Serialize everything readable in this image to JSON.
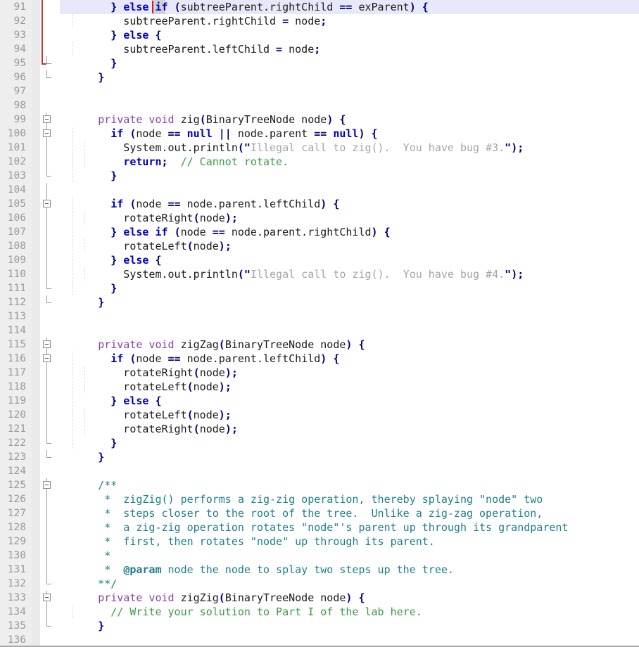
{
  "editor": {
    "language": "Java",
    "first_line": 91,
    "last_line": 136,
    "colors": {
      "background": "#ffffff",
      "gutter": "#eeeeee",
      "line_number": "#999999",
      "current_line_highlight": "#e8e8fb",
      "keyword": "#0000c8",
      "modifier": "#8b3fa8",
      "punctuation": "#000080",
      "string": "#a5a5a5",
      "line_comment": "#3a9b45",
      "javadoc": "#1c7f8c",
      "change_marker": "#c0392b",
      "caret": "#cc2222",
      "brace_match": "#c9c9c9"
    },
    "caret": {
      "line": 91,
      "column": 11
    },
    "brace_match_token": "if"
  },
  "lines": [
    {
      "n": 91,
      "current": true,
      "change": "bar",
      "indent": 0,
      "tokens": [
        {
          "t": "        ",
          "c": "id"
        },
        {
          "t": "}",
          "c": "p"
        },
        {
          "t": " ",
          "c": "id"
        },
        {
          "t": "else",
          "c": "k"
        },
        {
          "t": " ",
          "c": "id"
        },
        {
          "t": "if",
          "c": "k",
          "match": true
        },
        {
          "t": " ",
          "c": "id"
        },
        {
          "t": "(",
          "c": "p"
        },
        {
          "t": "subtreeParent.rightChild ",
          "c": "id"
        },
        {
          "t": "==",
          "c": "p"
        },
        {
          "t": " exParent",
          "c": "id"
        },
        {
          "t": ")",
          "c": "p"
        },
        {
          "t": " ",
          "c": "id"
        },
        {
          "t": "{",
          "c": "p"
        }
      ]
    },
    {
      "n": 92,
      "change": "bar",
      "indent": 1,
      "tokens": [
        {
          "t": "          subtreeParent.rightChild ",
          "c": "id"
        },
        {
          "t": "=",
          "c": "p"
        },
        {
          "t": " node",
          "c": "id"
        },
        {
          "t": ";",
          "c": "p"
        }
      ]
    },
    {
      "n": 93,
      "change": "bar",
      "indent": 0,
      "tokens": [
        {
          "t": "        ",
          "c": "id"
        },
        {
          "t": "}",
          "c": "p"
        },
        {
          "t": " ",
          "c": "id"
        },
        {
          "t": "else",
          "c": "k"
        },
        {
          "t": " ",
          "c": "id"
        },
        {
          "t": "{",
          "c": "p"
        }
      ]
    },
    {
      "n": 94,
      "change": "bar",
      "indent": 1,
      "tokens": [
        {
          "t": "          subtreeParent.leftChild ",
          "c": "id"
        },
        {
          "t": "=",
          "c": "p"
        },
        {
          "t": " node",
          "c": "id"
        },
        {
          "t": ";",
          "c": "p"
        }
      ]
    },
    {
      "n": 95,
      "change": "end",
      "fold": "stub",
      "indent": 0,
      "tokens": [
        {
          "t": "        ",
          "c": "id"
        },
        {
          "t": "}",
          "c": "p"
        }
      ]
    },
    {
      "n": 96,
      "fold": "stub",
      "tokens": [
        {
          "t": "      ",
          "c": "id"
        },
        {
          "t": "}",
          "c": "p"
        }
      ]
    },
    {
      "n": 97,
      "tokens": []
    },
    {
      "n": 98,
      "tokens": []
    },
    {
      "n": 99,
      "fold": "box",
      "tokens": [
        {
          "t": "      ",
          "c": "id"
        },
        {
          "t": "private void",
          "c": "mod"
        },
        {
          "t": " zig",
          "c": "id"
        },
        {
          "t": "(",
          "c": "p"
        },
        {
          "t": "BinaryTreeNode node",
          "c": "id"
        },
        {
          "t": ")",
          "c": "p"
        },
        {
          "t": " ",
          "c": "id"
        },
        {
          "t": "{",
          "c": "p"
        }
      ]
    },
    {
      "n": 100,
      "fold": "box",
      "indent": 1,
      "tokens": [
        {
          "t": "        ",
          "c": "id"
        },
        {
          "t": "if",
          "c": "k"
        },
        {
          "t": " ",
          "c": "id"
        },
        {
          "t": "(",
          "c": "p"
        },
        {
          "t": "node ",
          "c": "id"
        },
        {
          "t": "==",
          "c": "p"
        },
        {
          "t": " ",
          "c": "id"
        },
        {
          "t": "null",
          "c": "k"
        },
        {
          "t": " ",
          "c": "id"
        },
        {
          "t": "||",
          "c": "p"
        },
        {
          "t": " node.parent ",
          "c": "id"
        },
        {
          "t": "==",
          "c": "p"
        },
        {
          "t": " ",
          "c": "id"
        },
        {
          "t": "null",
          "c": "k"
        },
        {
          "t": ")",
          "c": "p"
        },
        {
          "t": " ",
          "c": "id"
        },
        {
          "t": "{",
          "c": "p"
        }
      ]
    },
    {
      "n": 101,
      "fold": "line",
      "indent": 2,
      "tokens": [
        {
          "t": "          System.out.println",
          "c": "id"
        },
        {
          "t": "(\"",
          "c": "p"
        },
        {
          "t": "Illegal call to zig().  You have bug #3.",
          "c": "str"
        },
        {
          "t": "\")",
          "c": "p"
        },
        {
          "t": ";",
          "c": "p"
        }
      ]
    },
    {
      "n": 102,
      "fold": "line",
      "indent": 2,
      "tokens": [
        {
          "t": "          ",
          "c": "id"
        },
        {
          "t": "return",
          "c": "k"
        },
        {
          "t": ";",
          "c": "p"
        },
        {
          "t": "  ",
          "c": "id"
        },
        {
          "t": "// Cannot rotate.",
          "c": "cm"
        }
      ]
    },
    {
      "n": 103,
      "fold": "stub",
      "indent": 1,
      "tokens": [
        {
          "t": "        ",
          "c": "id"
        },
        {
          "t": "}",
          "c": "p"
        }
      ]
    },
    {
      "n": 104,
      "fold": "line",
      "tokens": []
    },
    {
      "n": 105,
      "fold": "box",
      "indent": 1,
      "tokens": [
        {
          "t": "        ",
          "c": "id"
        },
        {
          "t": "if",
          "c": "k"
        },
        {
          "t": " ",
          "c": "id"
        },
        {
          "t": "(",
          "c": "p"
        },
        {
          "t": "node ",
          "c": "id"
        },
        {
          "t": "==",
          "c": "p"
        },
        {
          "t": " node.parent.leftChild",
          "c": "id"
        },
        {
          "t": ")",
          "c": "p"
        },
        {
          "t": " ",
          "c": "id"
        },
        {
          "t": "{",
          "c": "p"
        }
      ]
    },
    {
      "n": 106,
      "fold": "line",
      "indent": 2,
      "tokens": [
        {
          "t": "          rotateRight",
          "c": "id"
        },
        {
          "t": "(",
          "c": "p"
        },
        {
          "t": "node",
          "c": "id"
        },
        {
          "t": ")",
          "c": "p"
        },
        {
          "t": ";",
          "c": "p"
        }
      ]
    },
    {
      "n": 107,
      "fold": "line",
      "indent": 1,
      "tokens": [
        {
          "t": "        ",
          "c": "id"
        },
        {
          "t": "}",
          "c": "p"
        },
        {
          "t": " ",
          "c": "id"
        },
        {
          "t": "else",
          "c": "k"
        },
        {
          "t": " ",
          "c": "id"
        },
        {
          "t": "if",
          "c": "k"
        },
        {
          "t": " ",
          "c": "id"
        },
        {
          "t": "(",
          "c": "p"
        },
        {
          "t": "node ",
          "c": "id"
        },
        {
          "t": "==",
          "c": "p"
        },
        {
          "t": " node.parent.rightChild",
          "c": "id"
        },
        {
          "t": ")",
          "c": "p"
        },
        {
          "t": " ",
          "c": "id"
        },
        {
          "t": "{",
          "c": "p"
        }
      ]
    },
    {
      "n": 108,
      "fold": "line",
      "indent": 2,
      "tokens": [
        {
          "t": "          rotateLeft",
          "c": "id"
        },
        {
          "t": "(",
          "c": "p"
        },
        {
          "t": "node",
          "c": "id"
        },
        {
          "t": ")",
          "c": "p"
        },
        {
          "t": ";",
          "c": "p"
        }
      ]
    },
    {
      "n": 109,
      "fold": "line",
      "indent": 1,
      "tokens": [
        {
          "t": "        ",
          "c": "id"
        },
        {
          "t": "}",
          "c": "p"
        },
        {
          "t": " ",
          "c": "id"
        },
        {
          "t": "else",
          "c": "k"
        },
        {
          "t": " ",
          "c": "id"
        },
        {
          "t": "{",
          "c": "p"
        }
      ]
    },
    {
      "n": 110,
      "fold": "line",
      "indent": 2,
      "tokens": [
        {
          "t": "          System.out.println",
          "c": "id"
        },
        {
          "t": "(\"",
          "c": "p"
        },
        {
          "t": "Illegal call to zig().  You have bug #4.",
          "c": "str"
        },
        {
          "t": "\")",
          "c": "p"
        },
        {
          "t": ";",
          "c": "p"
        }
      ]
    },
    {
      "n": 111,
      "fold": "stub",
      "indent": 1,
      "tokens": [
        {
          "t": "        ",
          "c": "id"
        },
        {
          "t": "}",
          "c": "p"
        }
      ]
    },
    {
      "n": 112,
      "fold": "stub",
      "tokens": [
        {
          "t": "      ",
          "c": "id"
        },
        {
          "t": "}",
          "c": "p"
        }
      ]
    },
    {
      "n": 113,
      "tokens": []
    },
    {
      "n": 114,
      "tokens": []
    },
    {
      "n": 115,
      "fold": "box",
      "tokens": [
        {
          "t": "      ",
          "c": "id"
        },
        {
          "t": "private void",
          "c": "mod"
        },
        {
          "t": " zigZag",
          "c": "id"
        },
        {
          "t": "(",
          "c": "p"
        },
        {
          "t": "BinaryTreeNode node",
          "c": "id"
        },
        {
          "t": ")",
          "c": "p"
        },
        {
          "t": " ",
          "c": "id"
        },
        {
          "t": "{",
          "c": "p"
        }
      ]
    },
    {
      "n": 116,
      "fold": "box",
      "indent": 1,
      "tokens": [
        {
          "t": "        ",
          "c": "id"
        },
        {
          "t": "if",
          "c": "k"
        },
        {
          "t": " ",
          "c": "id"
        },
        {
          "t": "(",
          "c": "p"
        },
        {
          "t": "node ",
          "c": "id"
        },
        {
          "t": "==",
          "c": "p"
        },
        {
          "t": " node.parent.leftChild",
          "c": "id"
        },
        {
          "t": ")",
          "c": "p"
        },
        {
          "t": " ",
          "c": "id"
        },
        {
          "t": "{",
          "c": "p"
        }
      ]
    },
    {
      "n": 117,
      "fold": "line",
      "indent": 2,
      "tokens": [
        {
          "t": "          rotateRight",
          "c": "id"
        },
        {
          "t": "(",
          "c": "p"
        },
        {
          "t": "node",
          "c": "id"
        },
        {
          "t": ")",
          "c": "p"
        },
        {
          "t": ";",
          "c": "p"
        }
      ]
    },
    {
      "n": 118,
      "fold": "line",
      "indent": 2,
      "tokens": [
        {
          "t": "          rotateLeft",
          "c": "id"
        },
        {
          "t": "(",
          "c": "p"
        },
        {
          "t": "node",
          "c": "id"
        },
        {
          "t": ")",
          "c": "p"
        },
        {
          "t": ";",
          "c": "p"
        }
      ]
    },
    {
      "n": 119,
      "fold": "line",
      "indent": 1,
      "tokens": [
        {
          "t": "        ",
          "c": "id"
        },
        {
          "t": "}",
          "c": "p"
        },
        {
          "t": " ",
          "c": "id"
        },
        {
          "t": "else",
          "c": "k"
        },
        {
          "t": " ",
          "c": "id"
        },
        {
          "t": "{",
          "c": "p"
        }
      ]
    },
    {
      "n": 120,
      "fold": "line",
      "indent": 2,
      "tokens": [
        {
          "t": "          rotateLeft",
          "c": "id"
        },
        {
          "t": "(",
          "c": "p"
        },
        {
          "t": "node",
          "c": "id"
        },
        {
          "t": ")",
          "c": "p"
        },
        {
          "t": ";",
          "c": "p"
        }
      ]
    },
    {
      "n": 121,
      "fold": "line",
      "indent": 2,
      "tokens": [
        {
          "t": "          rotateRight",
          "c": "id"
        },
        {
          "t": "(",
          "c": "p"
        },
        {
          "t": "node",
          "c": "id"
        },
        {
          "t": ")",
          "c": "p"
        },
        {
          "t": ";",
          "c": "p"
        }
      ]
    },
    {
      "n": 122,
      "fold": "stub",
      "indent": 1,
      "tokens": [
        {
          "t": "        ",
          "c": "id"
        },
        {
          "t": "}",
          "c": "p"
        }
      ]
    },
    {
      "n": 123,
      "fold": "stub",
      "tokens": [
        {
          "t": "      ",
          "c": "id"
        },
        {
          "t": "}",
          "c": "p"
        }
      ]
    },
    {
      "n": 124,
      "tokens": []
    },
    {
      "n": 125,
      "fold": "box",
      "tokens": [
        {
          "t": "      /**",
          "c": "doc"
        }
      ]
    },
    {
      "n": 126,
      "fold": "line",
      "tokens": [
        {
          "t": "       *  zigZig() performs a zig-zig operation, thereby splaying \"node\" two",
          "c": "doc"
        }
      ]
    },
    {
      "n": 127,
      "fold": "line",
      "tokens": [
        {
          "t": "       *  steps closer to the root of the tree.  Unlike a zig-zag operation,",
          "c": "doc"
        }
      ]
    },
    {
      "n": 128,
      "fold": "line",
      "tokens": [
        {
          "t": "       *  a zig-zig operation rotates \"node\"'s parent up through its grandparent",
          "c": "doc"
        }
      ]
    },
    {
      "n": 129,
      "fold": "line",
      "tokens": [
        {
          "t": "       *  first, then rotates \"node\" up through its parent.",
          "c": "doc"
        }
      ]
    },
    {
      "n": 130,
      "fold": "line",
      "tokens": [
        {
          "t": "       *",
          "c": "doc"
        }
      ]
    },
    {
      "n": 131,
      "fold": "line",
      "tokens": [
        {
          "t": "       *  ",
          "c": "doc"
        },
        {
          "t": "@param",
          "c": "doct"
        },
        {
          "t": " node the node to splay two steps up the tree.",
          "c": "doc"
        }
      ]
    },
    {
      "n": 132,
      "fold": "stub",
      "tokens": [
        {
          "t": "      **/",
          "c": "doc"
        }
      ]
    },
    {
      "n": 133,
      "fold": "box",
      "tokens": [
        {
          "t": "      ",
          "c": "id"
        },
        {
          "t": "private void",
          "c": "mod"
        },
        {
          "t": " zigZig",
          "c": "id"
        },
        {
          "t": "(",
          "c": "p"
        },
        {
          "t": "BinaryTreeNode node",
          "c": "id"
        },
        {
          "t": ")",
          "c": "p"
        },
        {
          "t": " ",
          "c": "id"
        },
        {
          "t": "{",
          "c": "p"
        }
      ]
    },
    {
      "n": 134,
      "fold": "line",
      "indent": 1,
      "tokens": [
        {
          "t": "        ",
          "c": "id"
        },
        {
          "t": "// Write your solution to Part I of the lab here.",
          "c": "cm"
        }
      ]
    },
    {
      "n": 135,
      "fold": "stub",
      "tokens": [
        {
          "t": "      ",
          "c": "id"
        },
        {
          "t": "}",
          "c": "p"
        }
      ]
    },
    {
      "n": 136,
      "tokens": []
    }
  ]
}
